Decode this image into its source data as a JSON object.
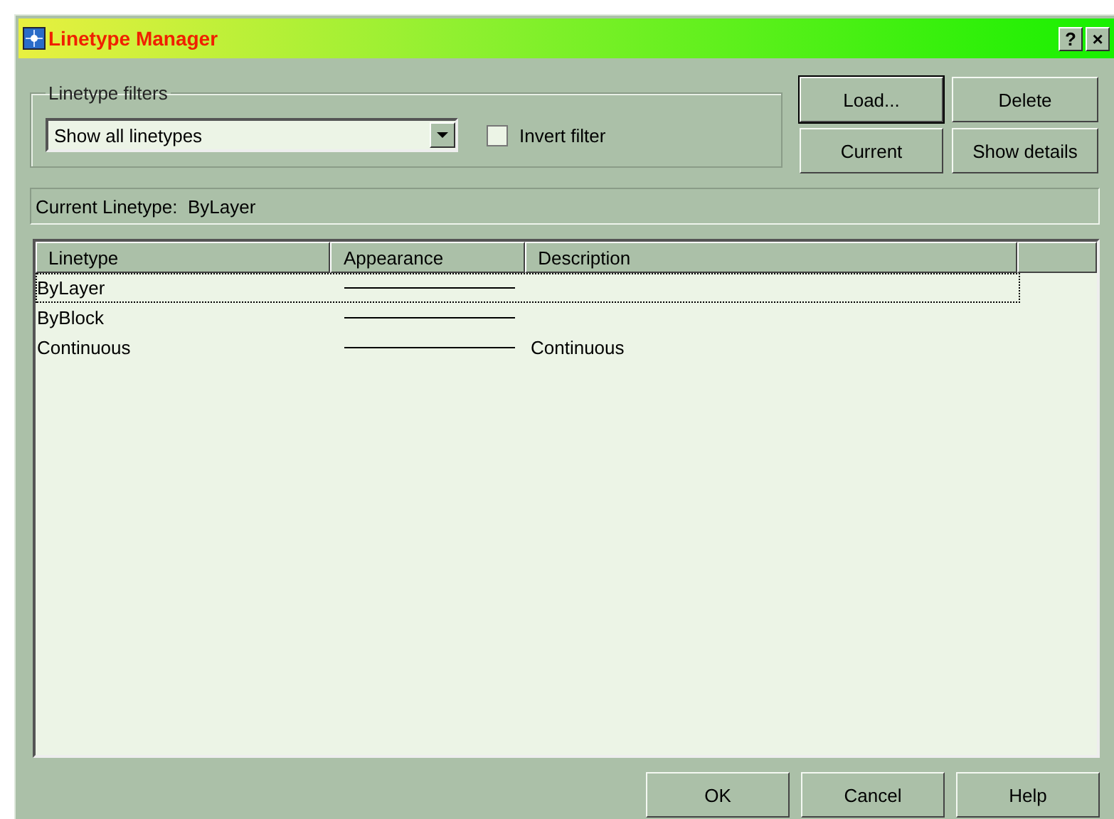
{
  "window": {
    "title": "Linetype Manager"
  },
  "title_buttons": [
    "?",
    "×"
  ],
  "filters": {
    "label": "Linetype filters",
    "dropdown": {
      "value": "Show all linetypes"
    },
    "invert": {
      "label": "Invert filter",
      "checked": false
    }
  },
  "buttons_top": [
    {
      "label": "Load...",
      "default": true
    },
    {
      "label": "Delete",
      "default": false
    },
    {
      "label": "Current",
      "default": false
    },
    {
      "label": "Show details",
      "default": false
    }
  ],
  "current_linetype": {
    "label": "Current Linetype:",
    "value": "ByLayer"
  },
  "table": {
    "columns": [
      "Linetype",
      "Appearance",
      "Description"
    ],
    "rows": [
      {
        "linetype": "ByLayer",
        "selected": true
      },
      {
        "linetype": "ByBlock",
        "selected": false
      },
      {
        "linetype": "Continuous",
        "description": "Continuous",
        "selected": false
      }
    ]
  },
  "buttons_bottom": [
    "OK",
    "Cancel",
    "Help"
  ]
}
